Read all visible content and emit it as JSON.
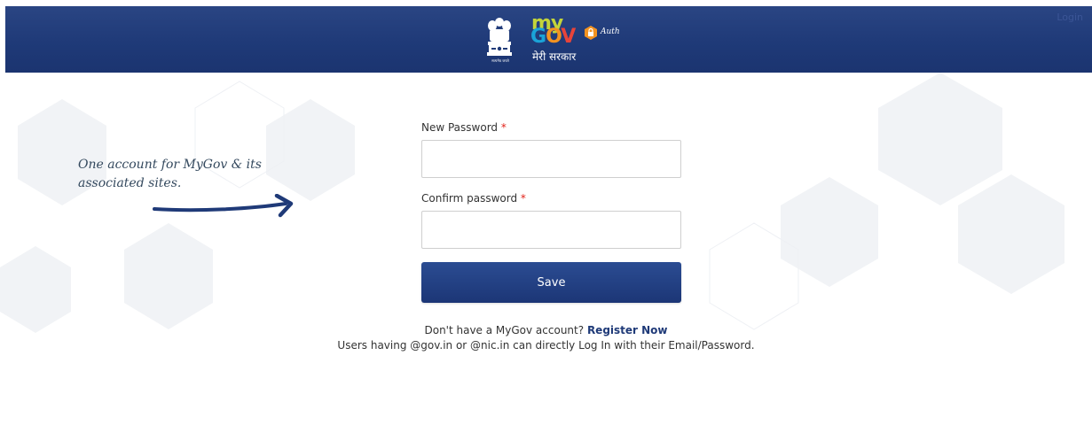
{
  "header": {
    "login_label": "Login",
    "logo": {
      "emblem_caption": "सत्यमेव जयते",
      "brand_my": "my",
      "brand_gov_g": "G",
      "brand_gov_o": "O",
      "brand_gov_v": "V",
      "brand_subtitle": "मेरी सरकार",
      "auth_label": "Auth",
      "icons": [
        "national-emblem-icon",
        "auth-badge-icon"
      ]
    },
    "colors": {
      "bar": "#1f3a78"
    }
  },
  "tagline": {
    "text": "One account for MyGov & its associated sites."
  },
  "form": {
    "new_password_label": "New Password",
    "confirm_password_label": "Confirm password",
    "required_mark": "*",
    "new_password_value": "",
    "confirm_password_value": "",
    "save_label": "Save"
  },
  "footer": {
    "no_account_text": "Don't have a MyGov account?",
    "register_link": "Register Now",
    "gov_users_note": "Users having @gov.in or @nic.in can directly Log In with their Email/Password."
  },
  "colors": {
    "primary": "#1f3a78",
    "required": "#e2231a",
    "button_top": "#2b4c92",
    "button_bottom": "#1c3676"
  }
}
